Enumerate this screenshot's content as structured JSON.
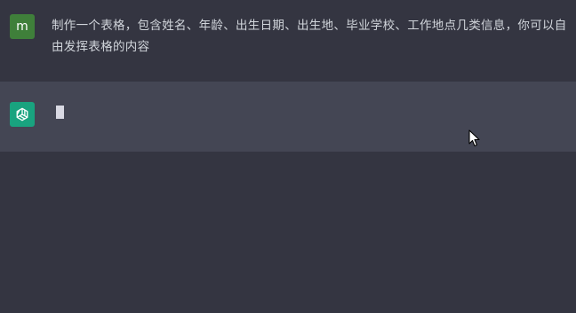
{
  "conversation": {
    "user_message": {
      "avatar_letter": "m",
      "text": "制作一个表格，包含姓名、年龄、出生日期、出生地、毕业学校、工作地点几类信息，你可以自由发挥表格的内容"
    },
    "assistant_message": {
      "avatar_icon": "openai-logo-icon",
      "text": ""
    }
  },
  "colors": {
    "background": "#343541",
    "assistant_background": "#444654",
    "user_avatar": "#3f7f3a",
    "assistant_avatar": "#19a37f",
    "text": "#d1d5db"
  }
}
